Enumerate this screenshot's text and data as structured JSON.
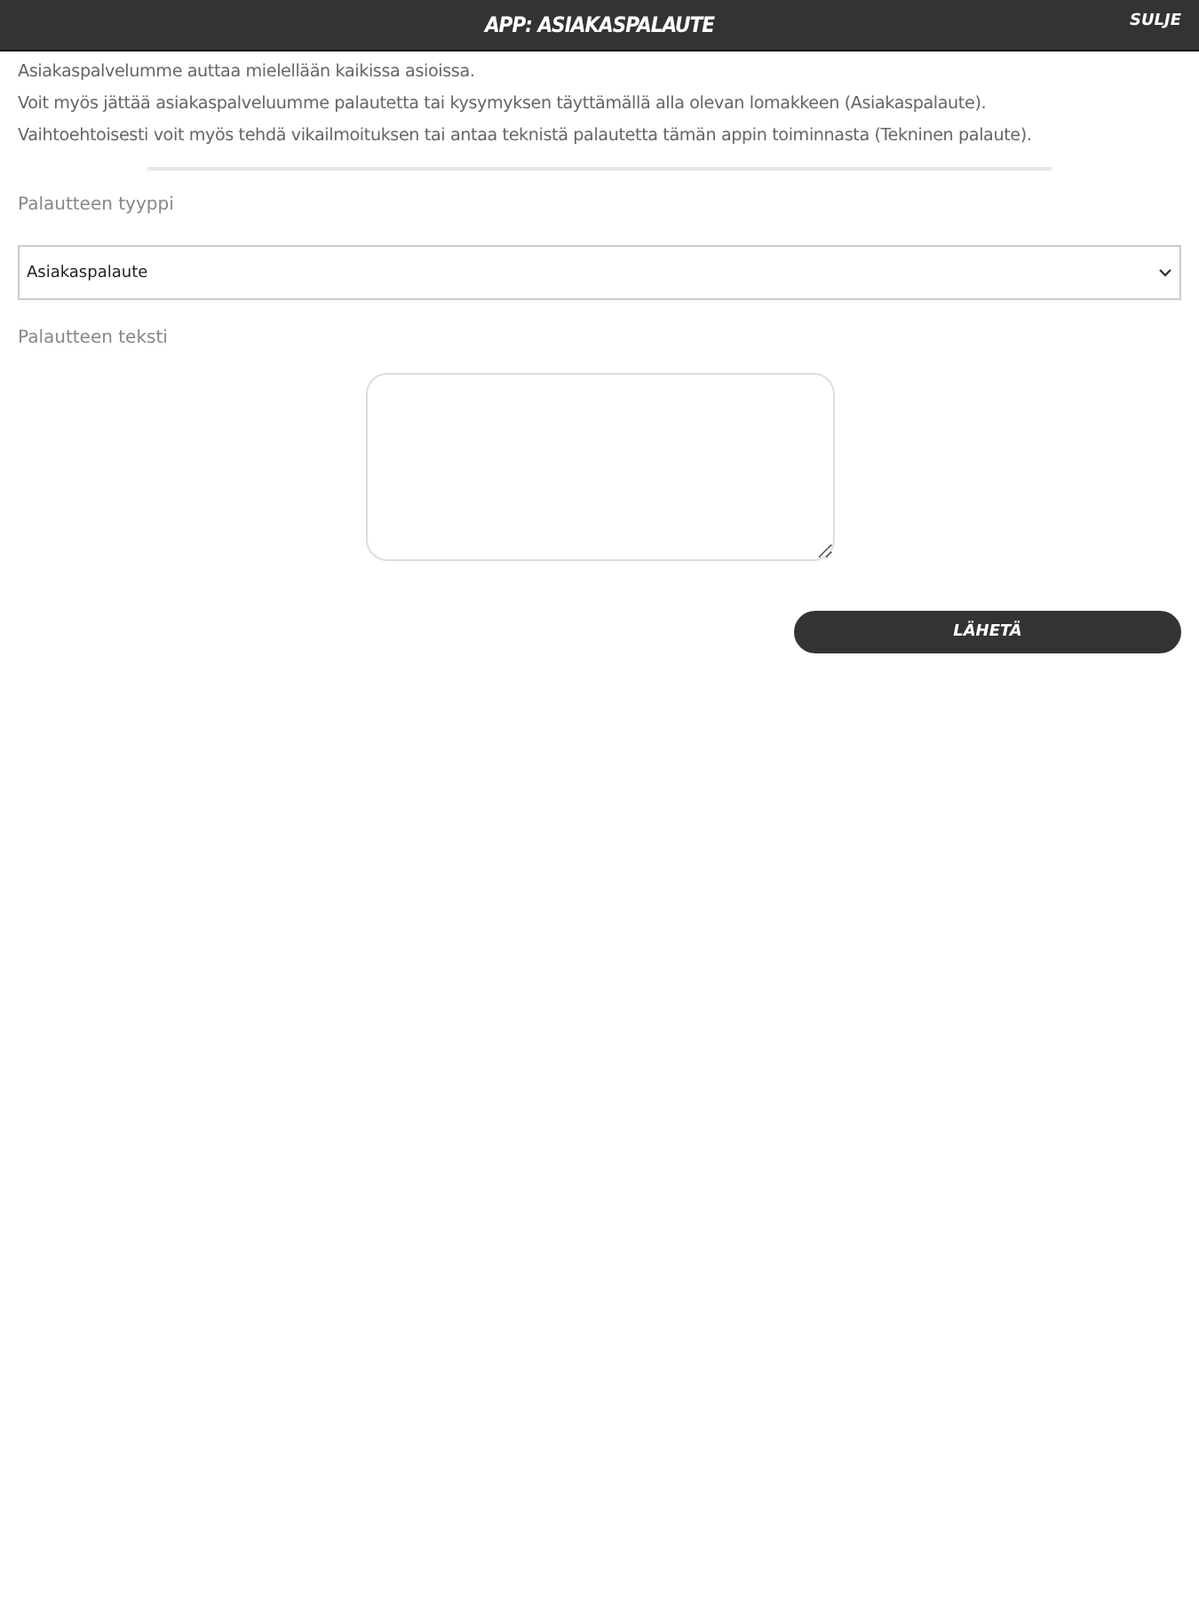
{
  "header": {
    "title": "APP: ASIAKASPALAUTE",
    "close": "SULJE"
  },
  "intro": [
    "Asiakaspalvelumme auttaa mielellään kaikissa asioissa.",
    "Voit myös jättää asiakaspalveluumme palautetta tai kysymyksen täyttämällä alla olevan lomakkeen (Asiakaspalaute).",
    "Vaihtoehtoisesti voit myös tehdä vikailmoituksen tai antaa teknistä palautetta tämän appin toiminnasta (Tekninen palaute)."
  ],
  "form": {
    "type_label": "Palautteen tyyppi",
    "type_value": "Asiakaspalaute",
    "text_label": "Palautteen teksti",
    "submit": "LÄHETÄ"
  }
}
